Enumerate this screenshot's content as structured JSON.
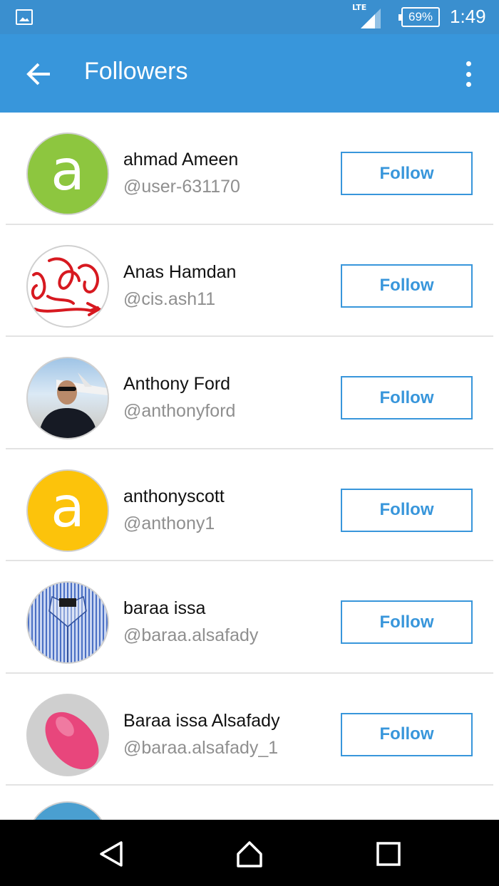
{
  "status_bar": {
    "network_type": "LTE",
    "battery_percent": "69%",
    "time": "1:49",
    "icons": [
      "image-notification-icon",
      "signal-icon",
      "battery-icon"
    ]
  },
  "app_bar": {
    "title": "Followers",
    "back_icon": "back-arrow-icon",
    "menu_icon": "overflow-menu-icon"
  },
  "followers": [
    {
      "name": "ahmad Ameen",
      "handle": "@user-631170",
      "follow_label": "Follow",
      "avatar_letter": "a",
      "avatar_color": "#8dc63f"
    },
    {
      "name": "Anas Hamdan",
      "handle": "@cis.ash11",
      "follow_label": "Follow",
      "avatar_type": "scribble"
    },
    {
      "name": "Anthony Ford",
      "handle": "@anthonyford",
      "follow_label": "Follow",
      "avatar_type": "photo-person"
    },
    {
      "name": "anthonyscott",
      "handle": "@anthony1",
      "follow_label": "Follow",
      "avatar_letter": "a",
      "avatar_color": "#fcc30b"
    },
    {
      "name": "baraa issa",
      "handle": "@baraa.alsafady",
      "follow_label": "Follow",
      "avatar_type": "photo-shirt"
    },
    {
      "name": "Baraa issa Alsafady",
      "handle": "@baraa.alsafady_1",
      "follow_label": "Follow",
      "avatar_type": "photo-mouse"
    }
  ],
  "colors": {
    "status_bar": "#3a8fcf",
    "app_bar": "#3896db",
    "accent": "#3896db",
    "handle_text": "#8f8f8f"
  },
  "nav_bar": {
    "icons": [
      "back-triangle-icon",
      "home-icon",
      "recents-square-icon"
    ]
  }
}
